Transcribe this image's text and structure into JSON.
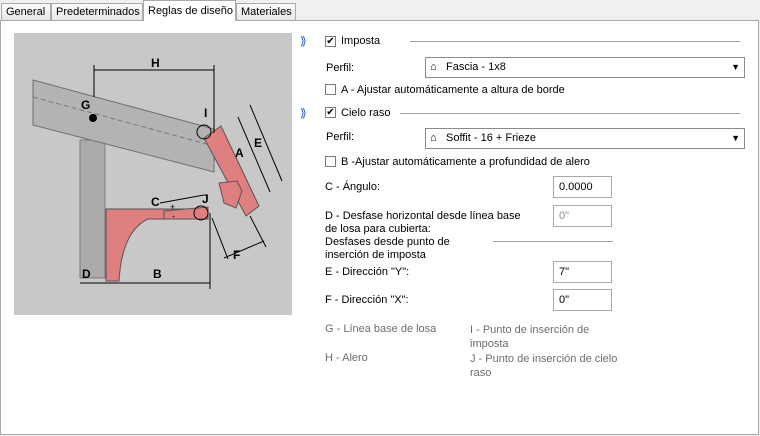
{
  "tabs": [
    {
      "label": "General"
    },
    {
      "label": "Predeterminados"
    },
    {
      "label": "Reglas de diseño"
    },
    {
      "label": "Materiales"
    }
  ],
  "diagram": {
    "labels": {
      "H": "H",
      "G": "G",
      "I": "I",
      "A": "A",
      "E": "E",
      "C": "C",
      "J": "J",
      "F": "F",
      "D": "D",
      "B": "B",
      "plus": "+",
      "minus": "-"
    }
  },
  "imposta": {
    "checkbox_label": "Imposta",
    "checked": true,
    "profile_label": "Perfil:",
    "profile_value": "Fascia - 1x8",
    "auto_label": "A - Ajustar automáticamente a altura de borde",
    "auto_checked": false
  },
  "cielo": {
    "checkbox_label": "Cielo raso",
    "checked": true,
    "profile_label": "Perfil:",
    "profile_value": "Soffit - 16 + Frieze",
    "auto_label": "B -Ajustar automáticamente a profundidad de alero",
    "auto_checked": false
  },
  "fields": {
    "angle_label": "C - Ángulo:",
    "angle_value": "0.0000",
    "offset_label": "D - Desfase horizontal desde línea base de losa para cubierta:",
    "offset_value": "0\"",
    "group_label": "Desfases desde punto de inserción de imposta",
    "dir_y_label": "E - Dirección \"Y\":",
    "dir_y_value": "7\"",
    "dir_x_label": "F - Dirección \"X\":",
    "dir_x_value": "0\""
  },
  "legend": [
    {
      "text": "G - Línea base de losa"
    },
    {
      "text": "I - Punto de inserción de imposta"
    },
    {
      "text": "H - Alero"
    },
    {
      "text": "J - Punto de inserción de cielo raso"
    }
  ],
  "colors": {
    "accent_red": "#e07f80",
    "diagram_bg": "#c8c8c8"
  }
}
